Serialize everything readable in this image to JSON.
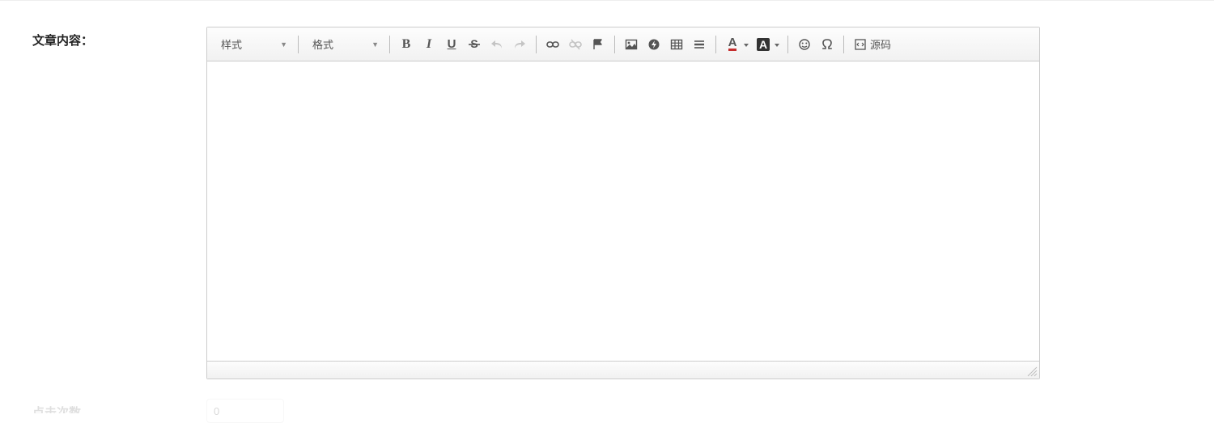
{
  "labels": {
    "article_content": "文章内容：",
    "second_field": "点击次数"
  },
  "toolbar": {
    "style_combo": "样式",
    "format_combo": "格式",
    "bold": "B",
    "italic": "I",
    "underline": "U",
    "text_color_glyph": "A",
    "bg_color_glyph": "A",
    "source_label": "源码"
  },
  "editor": {
    "content": ""
  },
  "second_input": {
    "value": "0"
  }
}
